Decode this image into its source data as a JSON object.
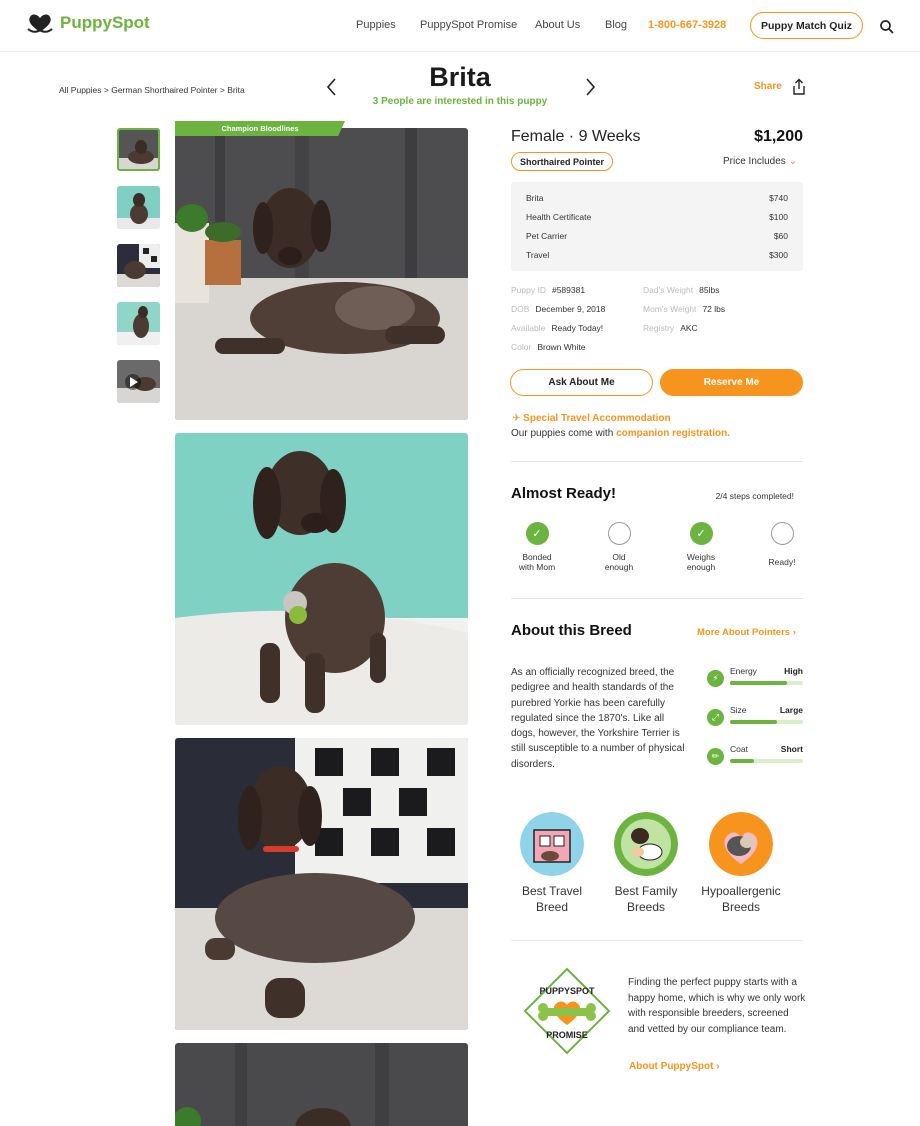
{
  "brand": {
    "name": "PuppySpot",
    "accent": "#6cb33f",
    "orange": "#f7941d"
  },
  "nav": {
    "items": [
      "Puppies",
      "PuppySpot Promise",
      "About Us",
      "Blog"
    ],
    "phone": "1-800-667-3928",
    "quiz_label": "Puppy Match Quiz"
  },
  "breadcrumb": {
    "text": "All Puppies > German Shorthaired Pointer > Brita"
  },
  "puppy": {
    "name": "Brita",
    "interest": "3 People are interested in this puppy",
    "share_label": "Share",
    "ribbon": "Champion Bloodlines",
    "sex_age": "Female · 9 Weeks",
    "price": "$1,200",
    "breed": "Shorthaired Pointer",
    "price_includes_label": "Price Includes",
    "price_lines": [
      {
        "label": "Brita",
        "value": "$740"
      },
      {
        "label": "Health Certificate",
        "value": "$100"
      },
      {
        "label": "Pet Carrier",
        "value": "$60"
      },
      {
        "label": "Travel",
        "value": "$300"
      }
    ],
    "facts": {
      "id_label": "Puppy ID",
      "id_value": "#589381",
      "dob_label": "DOB",
      "dob_value": "December 9, 2018",
      "available_label": "Available",
      "available_value": "Ready Today!",
      "color_label": "Color",
      "color_value": "Brown White",
      "dad_label": "Dad's Weight",
      "dad_value": "85lbs",
      "mom_label": "Mom's Weight",
      "mom_value": "72 lbs",
      "registry_label": "Registry",
      "registry_value": "AKC"
    },
    "ask_label": "Ask About Me",
    "reserve_label": "Reserve Me",
    "travel_label": "Special Travel Accommodation",
    "companion_text": "Our puppies come with ",
    "companion_link": "companion registration."
  },
  "readiness": {
    "title": "Almost Ready!",
    "progress": "2/4 steps completed!",
    "steps": [
      {
        "label1": "Bonded",
        "label2": "with Mom",
        "done": true
      },
      {
        "label1": "Old",
        "label2": "enough",
        "done": false
      },
      {
        "label1": "Weighs",
        "label2": "enough",
        "done": true
      },
      {
        "label1": "Ready!",
        "label2": "",
        "done": false
      }
    ]
  },
  "breed_info": {
    "title": "About this Breed",
    "more_label": "More About Pointers",
    "text": "As an officially recognized breed, the pedigree and health standards of the purebred Yorkie has been carefully regulated since the 1870's. Like all dogs, however, the Yorkshire Terrier is still susceptible to a number of physical disorders.",
    "traits": [
      {
        "name": "Energy",
        "level": "High",
        "fill": 0.78
      },
      {
        "name": "Size",
        "level": "Large",
        "fill": 0.65
      },
      {
        "name": "Coat",
        "level": "Short",
        "fill": 0.33
      }
    ],
    "categories": [
      {
        "label1": "Best Travel",
        "label2": "Breed"
      },
      {
        "label1": "Best Family",
        "label2": "Breeds"
      },
      {
        "label1": "Hypoallergenic",
        "label2": "Breeds"
      }
    ]
  },
  "promise": {
    "logo_top": "PUPPYSPOT",
    "logo_bottom": "PROMISE",
    "text": "Finding the perfect puppy starts with a happy home, which is why we only work with responsible breeders, screened and vetted by our compliance team.",
    "link_label": "About PuppySpot"
  }
}
